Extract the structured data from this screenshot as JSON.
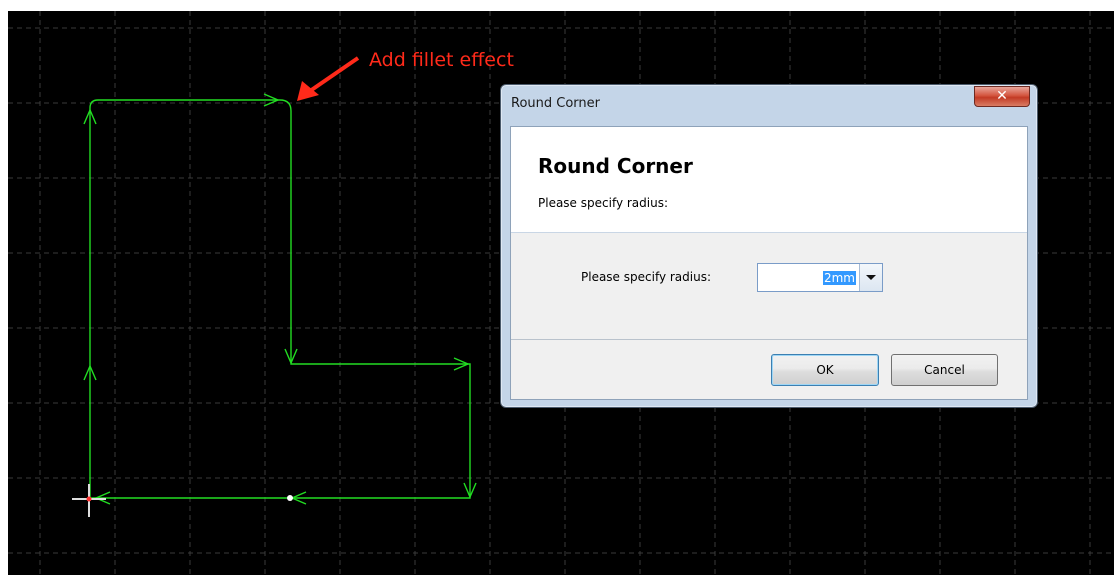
{
  "annotation": {
    "text": "Add fillet effect",
    "color": "#ff2a1a"
  },
  "canvas": {
    "background": "#000000",
    "grid_color": "#3a3a3a",
    "path_color": "#22dd22"
  },
  "dialog": {
    "window_title": "Round Corner",
    "close_symbol": "✕",
    "heading": "Round Corner",
    "subheading": "Please specify radius:",
    "field_label": "Please specify radius:",
    "radius_value": "2mm",
    "ok_label": "OK",
    "cancel_label": "Cancel"
  }
}
